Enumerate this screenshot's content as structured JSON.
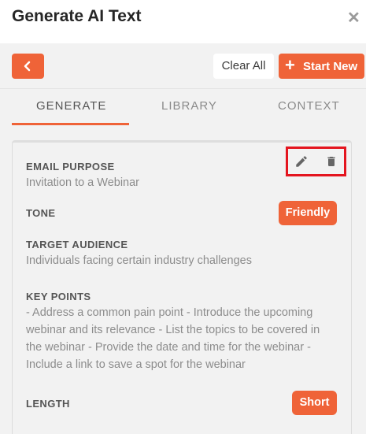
{
  "header": {
    "title": "Generate AI Text",
    "close_glyph": "✕"
  },
  "toolbar": {
    "back_icon": "chevron-left-icon",
    "clear_label": "Clear All",
    "start_icon": "plus-icon",
    "start_label": "Start New"
  },
  "tabs": [
    {
      "label": "GENERATE",
      "active": true
    },
    {
      "label": "LIBRARY",
      "active": false
    },
    {
      "label": "CONTEXT",
      "active": false
    }
  ],
  "card": {
    "actions": [
      "pencil-icon",
      "trash-icon"
    ],
    "email_purpose": {
      "label": "EMAIL PURPOSE",
      "value": "Invitation to a Webinar"
    },
    "tone": {
      "label": "TONE",
      "value": "Friendly"
    },
    "target_audience": {
      "label": "TARGET AUDIENCE",
      "value": "Individuals facing certain industry challenges"
    },
    "key_points": {
      "label": "KEY POINTS",
      "lines": [
        "- Address a common pain point - Introduce the upcoming",
        "webinar and its relevance - List the topics to be covered in",
        "the webinar - Provide the date and time for the webinar -",
        "Include a link to save a spot for the webinar"
      ]
    },
    "length": {
      "label": "LENGTH",
      "value": "Short"
    }
  },
  "colors": {
    "accent": "#ef6338",
    "highlight": "#e4151f"
  }
}
